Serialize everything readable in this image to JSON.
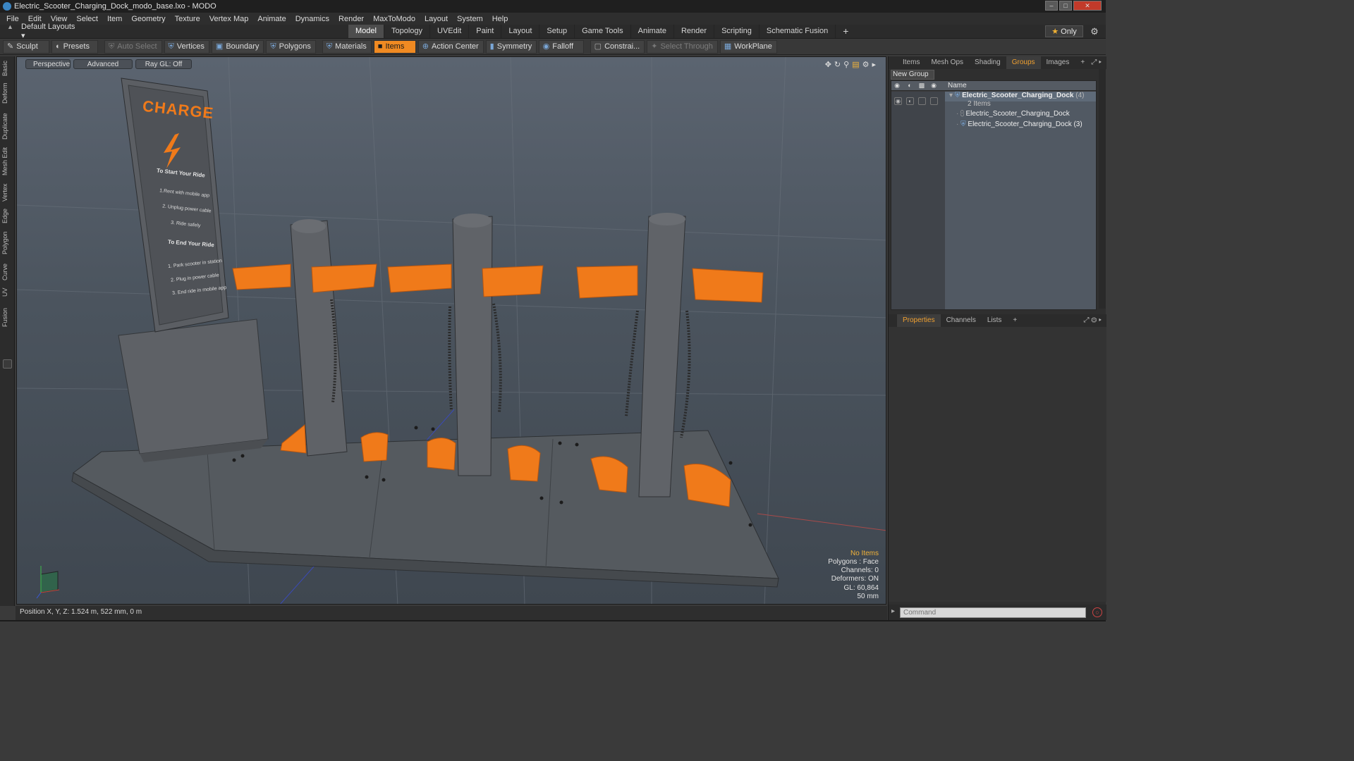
{
  "window": {
    "title": "Electric_Scooter_Charging_Dock_modo_base.lxo - MODO",
    "buttons": [
      "–",
      "□",
      "✕"
    ]
  },
  "menu": [
    "File",
    "Edit",
    "View",
    "Select",
    "Item",
    "Geometry",
    "Texture",
    "Vertex Map",
    "Animate",
    "Dynamics",
    "Render",
    "MaxToModo",
    "Layout",
    "System",
    "Help"
  ],
  "layouts": {
    "dropdown": "Default Layouts",
    "tabs": [
      "Model",
      "Topology",
      "UVEdit",
      "Paint",
      "Layout",
      "Setup",
      "Game Tools",
      "Animate",
      "Render",
      "Scripting",
      "Schematic Fusion"
    ],
    "active_tab": "Model",
    "add": "+",
    "only": "Only"
  },
  "toolbar": {
    "sculpt": "Sculpt",
    "presets": "Presets",
    "auto_select": "Auto Select",
    "vertices": "Vertices",
    "boundary": "Boundary",
    "polygons": "Polygons",
    "materials": "Materials",
    "items": "Items",
    "action_center": "Action Center",
    "symmetry": "Symmetry",
    "falloff": "Falloff",
    "constraints": "Constrai...",
    "select_through": "Select Through",
    "workplane": "WorkPlane"
  },
  "left_tabs": [
    "Basic",
    "Deform",
    "Duplicate",
    "Mesh Edit",
    "Vertex",
    "Edge",
    "Polygon",
    "Curve",
    "UV",
    "Fusion"
  ],
  "viewport": {
    "view": "Perspective",
    "mode": "Advanced",
    "raygl": "Ray GL: Off",
    "sign_text": {
      "title": "CHARGE",
      "start": "To Start Your Ride",
      "s1": "1.Rent with mobile app",
      "s2": "2. Unplug power cable",
      "s3": "3. Ride safely",
      "end": "To End Your Ride",
      "e1": "1. Park scooter in station",
      "e2": "2. Plug in power cable",
      "e3": "3. End ride in mobile app"
    },
    "hud": {
      "no_items": "No Items",
      "polygons": "Polygons : Face",
      "channels": "Channels: 0",
      "deformers": "Deformers: ON",
      "gl": "GL: 60,864",
      "scale": "50 mm"
    }
  },
  "status": {
    "position": "Position X, Y, Z:   1.524 m, 522 mm, 0 m"
  },
  "right_panel": {
    "tabs": [
      "Items",
      "Mesh Ops",
      "Shading",
      "Groups",
      "Images"
    ],
    "active_tab": "Groups",
    "new_group": "New Group",
    "column_name": "Name",
    "group_name": "Electric_Scooter_Charging_Dock",
    "group_count": "(4)",
    "group_sub": "2 Items",
    "children": [
      "Electric_Scooter_Charging_Dock",
      "Electric_Scooter_Charging_Dock (3)"
    ],
    "bottom_tabs": [
      "Properties",
      "Channels",
      "Lists"
    ],
    "bottom_active": "Properties",
    "command_placeholder": "Command"
  },
  "colors": {
    "accent": "#f08a22",
    "selected_tab": "#f0a030",
    "orange_model": "#f07a1a",
    "gray_model": "#5e5e5e"
  }
}
